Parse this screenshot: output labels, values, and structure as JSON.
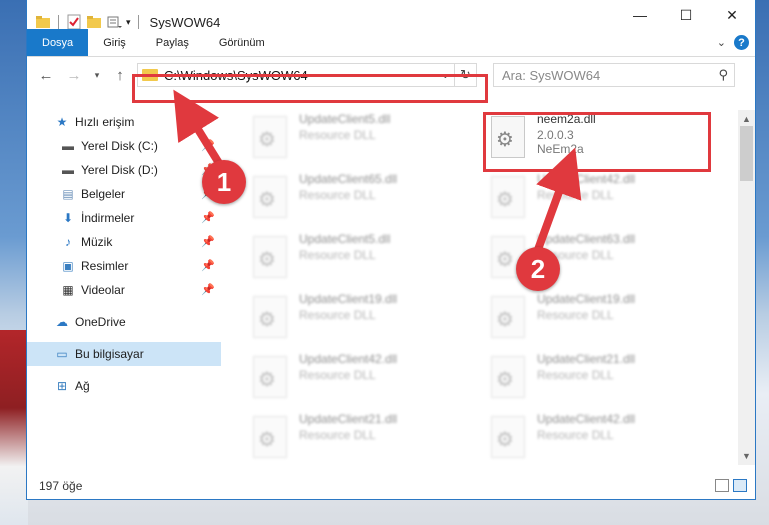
{
  "window": {
    "title": "SysWOW64",
    "controls": {
      "minimize": "—",
      "maximize": "☐",
      "close": "✕"
    }
  },
  "ribbon": {
    "tabs": [
      "Dosya",
      "Giriş",
      "Paylaş",
      "Görünüm"
    ],
    "expand_icon": "chevron-down-icon",
    "help": "?"
  },
  "navigation": {
    "address": "C:\\Windows\\SysWOW64",
    "search_placeholder": "Ara: SysWOW64"
  },
  "sidebar": {
    "items": [
      {
        "label": "Hızlı erişim",
        "icon": "star-icon",
        "pinned": false
      },
      {
        "label": "Yerel Disk (C:)",
        "icon": "drive-icon",
        "pinned": true
      },
      {
        "label": "Yerel Disk (D:)",
        "icon": "drive-icon",
        "pinned": true
      },
      {
        "label": "Belgeler",
        "icon": "document-icon",
        "pinned": true
      },
      {
        "label": "İndirmeler",
        "icon": "download-icon",
        "pinned": true
      },
      {
        "label": "Müzik",
        "icon": "music-icon",
        "pinned": true
      },
      {
        "label": "Resimler",
        "icon": "picture-icon",
        "pinned": true
      },
      {
        "label": "Videolar",
        "icon": "video-icon",
        "pinned": true
      },
      {
        "label": "OneDrive",
        "icon": "cloud-icon",
        "pinned": false
      },
      {
        "label": "Bu bilgisayar",
        "icon": "computer-icon",
        "pinned": false,
        "selected": true
      },
      {
        "label": "Ağ",
        "icon": "network-icon",
        "pinned": false
      }
    ]
  },
  "files": {
    "highlighted": {
      "name": "neem2a.dll",
      "version": "2.0.0.3",
      "description": "NeEm2a"
    },
    "left_column": [
      {
        "name": "UpdateClient5.dll",
        "type": "Resource DLL"
      },
      {
        "name": "UpdateClient65.dll",
        "type": "Resource DLL"
      },
      {
        "name": "UpdateClient5.dll",
        "type": "Resource DLL"
      },
      {
        "name": "UpdateClient19.dll",
        "type": "Resource DLL"
      },
      {
        "name": "UpdateClient42.dll",
        "type": "Resource DLL"
      },
      {
        "name": "UpdateClient21.dll",
        "type": "Resource DLL"
      }
    ],
    "right_column": [
      {
        "name": "UpdateClient42.dll",
        "type": "Resource DLL"
      },
      {
        "name": "UpdateClient63.dll",
        "type": "Resource DLL"
      },
      {
        "name": "UpdateClient19.dll",
        "type": "Resource DLL"
      },
      {
        "name": "UpdateClient21.dll",
        "type": "Resource DLL"
      },
      {
        "name": "UpdateClient42.dll",
        "type": "Resource DLL"
      }
    ]
  },
  "status": {
    "item_count": "197 öğe"
  },
  "annotations": {
    "marker_1": "1",
    "marker_2": "2",
    "color": "#e0393e"
  }
}
